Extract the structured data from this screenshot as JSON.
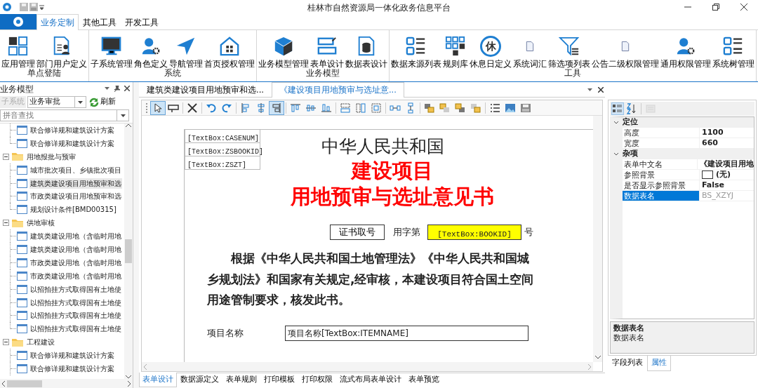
{
  "window": {
    "title": "桂林市自然资源局一体化政务信息平台"
  },
  "ribbon": {
    "tabs": [
      {
        "label": "业务定制",
        "selected": true
      },
      {
        "label": "其他工具",
        "selected": false
      },
      {
        "label": "开发工具",
        "selected": false
      }
    ],
    "groups": [
      {
        "label": "单点登陆",
        "items": [
          {
            "label": "应用管理"
          },
          {
            "label": "部门用户定义"
          }
        ]
      },
      {
        "label": "系统",
        "items": [
          {
            "label": "子系统管理"
          },
          {
            "label": "角色定义"
          },
          {
            "label": "导航管理"
          },
          {
            "label": "首页授权管理"
          }
        ]
      },
      {
        "label": "业务模型",
        "items": [
          {
            "label": "业务模型管理"
          },
          {
            "label": "表单设计"
          },
          {
            "label": "数据表设计"
          }
        ]
      },
      {
        "label": "工具",
        "items": [
          {
            "label": "数据来源列表"
          },
          {
            "label": "规则库"
          },
          {
            "label": "休息日定义",
            "icon_glyph": "休"
          },
          {
            "label": "系统词汇"
          },
          {
            "label": "筛选项列表"
          },
          {
            "label": "公告二级权限管理"
          },
          {
            "label": "通用权限管理"
          },
          {
            "label": "系统树管理"
          }
        ]
      }
    ]
  },
  "left_panel": {
    "title": "业务模型",
    "subsystem": {
      "label": "子系统",
      "disabled": true,
      "value": "业务审批"
    },
    "refresh_button": "刷新",
    "search": {
      "placeholder": "拼音查找"
    },
    "tree": [
      {
        "children": [
          {
            "label": "联合修详规和建筑设计方案",
            "selected": false
          },
          {
            "label": "联合修详规和建筑设计方案",
            "selected": false
          }
        ]
      },
      {
        "label": "用地报批与预审",
        "expanded": true,
        "children": [
          {
            "label": "城市批次项目、乡镇批次项目",
            "selected": false
          },
          {
            "label": "建筑类建设项目用地预审和选",
            "selected": true
          },
          {
            "label": "市政类建设项目用地预审和选",
            "selected": false
          },
          {
            "label": "规划设计条件[BMD00315]",
            "selected": false
          }
        ]
      },
      {
        "label": "供地审核",
        "expanded": true,
        "children": [
          {
            "label": "建筑类建设用地（含临时用地",
            "selected": false
          },
          {
            "label": "建筑类建设用地（含临时用地",
            "selected": false
          },
          {
            "label": "市政类建设用地（含临时用地",
            "selected": false
          },
          {
            "label": "市政类建设用地（含临时用地",
            "selected": false
          },
          {
            "label": "以招拍挂方式取得国有土地使",
            "selected": false
          },
          {
            "label": "以招拍挂方式取得国有土地使",
            "selected": false
          },
          {
            "label": "以招拍挂方式取得国有土地使",
            "selected": false
          },
          {
            "label": "以招拍挂方式取得国有土地使",
            "selected": false
          }
        ]
      },
      {
        "label": "工程建设",
        "expanded": true,
        "children": [
          {
            "label": "联合修详规和建筑设计方案",
            "selected": false
          },
          {
            "label": "联合修详规和建筑设计方案",
            "selected": false
          }
        ]
      }
    ]
  },
  "document_tabs": [
    {
      "label": "建筑类建设项目用地预审和选...",
      "selected": false
    },
    {
      "label": "《建设项目用地预审与选址意...",
      "selected": true
    }
  ],
  "designer_tools": [
    {
      "selected": true
    },
    {
      "selected": false
    },
    {
      "selected": false
    },
    {
      "selected": false
    },
    {
      "selected": false
    },
    {
      "selected": false
    },
    {
      "selected": false
    },
    {
      "selected": true
    },
    {
      "selected": false
    },
    {
      "selected": false
    },
    {
      "selected": false
    },
    {
      "selected": false
    },
    {
      "selected": false
    },
    {
      "selected": false
    },
    {
      "selected": false
    },
    {
      "selected": false
    },
    {
      "selected": false
    },
    {
      "selected": false
    },
    {
      "selected": false
    },
    {
      "selected": false
    },
    {
      "selected": false
    },
    {
      "selected": false
    },
    {
      "selected": false
    }
  ],
  "form": {
    "header_fields": [
      "[TextBox:CASENUM]",
      "[TextBox:ZSBOOKID]",
      "[TextBox:ZSZT]"
    ],
    "title": "中华人民共和国",
    "subtitle_lines": [
      "建设项目",
      "用地预审与选址意见书"
    ],
    "number_row": {
      "button": "证书取号",
      "prefix": "用字第",
      "field": "[TextBox:BOOKID]",
      "suffix": "号"
    },
    "paragraph": "根据《中华人民共和国土地管理法》《中华人民共和国城乡规划法》和国家有关规定,经审核，本建设项目符合国土空间用途管制要求，核发此书。",
    "fields": [
      {
        "label": "项目名称",
        "value": "项目名称[TextBox:ITEMNAME]"
      }
    ]
  },
  "bottom_tabs": [
    {
      "label": "表单设计",
      "selected": true
    },
    {
      "label": "数据源定义",
      "selected": false
    },
    {
      "label": "表单规则",
      "selected": false
    },
    {
      "label": "打印模板",
      "selected": false
    },
    {
      "label": "打印权限",
      "selected": false
    },
    {
      "label": "流式布局表单设计",
      "selected": false
    },
    {
      "label": "表单预览",
      "selected": false
    }
  ],
  "property_toolbar": [
    {
      "selected": true,
      "disabled": false
    },
    {
      "selected": false,
      "disabled": false
    },
    {
      "selected": false,
      "disabled": true
    }
  ],
  "properties": [
    {
      "category": "定位",
      "expanded": true,
      "rows": [
        {
          "name": "高度",
          "value": "1100",
          "selected": false,
          "readonly": false
        },
        {
          "name": "宽度",
          "value": "660",
          "selected": false,
          "readonly": false
        }
      ]
    },
    {
      "category": "杂项",
      "expanded": true,
      "rows": [
        {
          "name": "表单中文名",
          "value": "《建设项目用地",
          "selected": false,
          "readonly": false
        },
        {
          "name": "参照背景",
          "value": "(无)",
          "kind": "color",
          "selected": false,
          "readonly": false
        },
        {
          "name": "是否显示参照背景",
          "value": "False",
          "selected": false,
          "readonly": false
        },
        {
          "name": "数据表名",
          "value": "BS_XZYJ",
          "selected": true,
          "readonly": true
        }
      ]
    }
  ],
  "property_description": {
    "title": "数据表名",
    "text": "数据表名"
  },
  "right_tabs": [
    {
      "label": "字段列表",
      "selected": false
    },
    {
      "label": "属性",
      "selected": true
    }
  ]
}
